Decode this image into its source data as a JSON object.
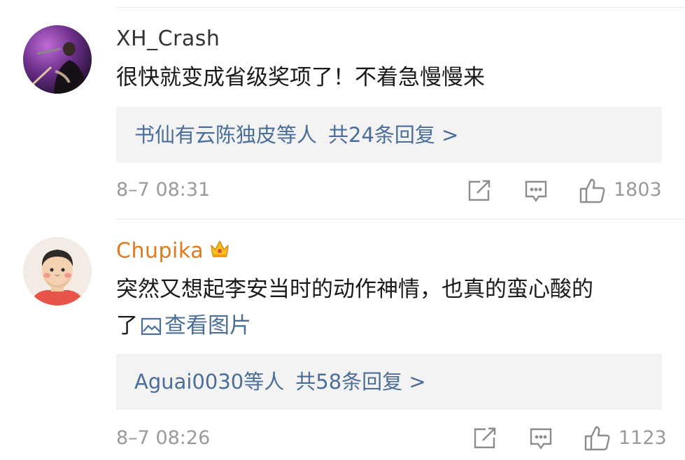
{
  "comments": [
    {
      "username": "XH_Crash",
      "username_color": "#333333",
      "text": "很快就变成省级奖项了！不着急慢慢来",
      "replies": {
        "users": "书仙有云陈独皮等人",
        "count": "共24条回复 >"
      },
      "timestamp": "8–7 08:31",
      "likes": "1803"
    },
    {
      "username": "Chupika",
      "username_color": "#e07a1f",
      "text_line1": "突然又想起李安当时的动作神情，也真的蛮心酸的",
      "text_line2": "了",
      "view_image": "查看图片",
      "replies": {
        "users": "Aguai0030等人",
        "count": "共58条回复 >"
      },
      "timestamp": "8–7 08:26",
      "likes": "1123"
    }
  ],
  "icons": {
    "share": "share-icon",
    "comment": "comment-icon",
    "like": "thumbs-up-icon",
    "crown": "vip-crown-icon",
    "picture": "picture-icon"
  },
  "colors": {
    "link": "#4a6e99",
    "meta": "#9a9a9a",
    "reply_bg": "#f3f3f3",
    "vip_name": "#e07a1f"
  }
}
